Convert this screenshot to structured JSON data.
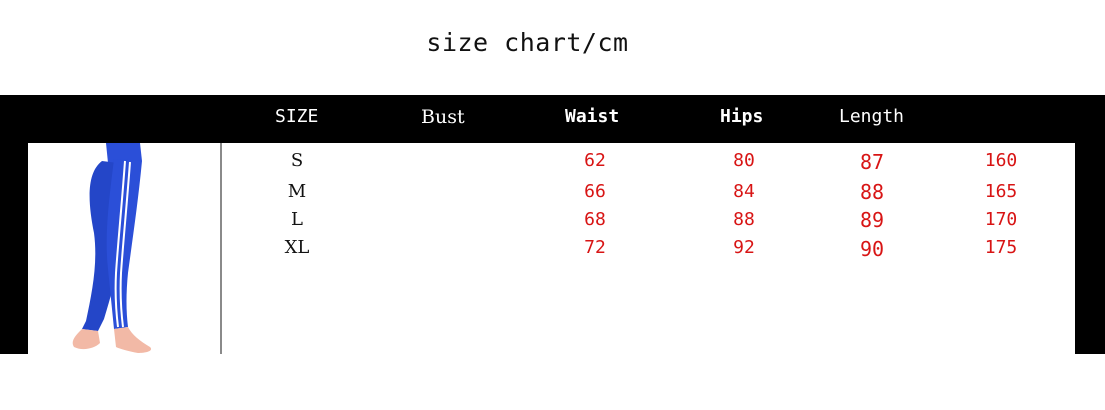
{
  "title": "size chart/cm",
  "headers": {
    "size": "SIZE",
    "bust": "Bust",
    "waist": "Waist",
    "hips": "Hips",
    "length": "Length"
  },
  "rows": [
    {
      "size": "S",
      "c1": "62",
      "c2": "80",
      "c3": "87",
      "c4": "160"
    },
    {
      "size": "M",
      "c1": "66",
      "c2": "84",
      "c3": "88",
      "c4": "165"
    },
    {
      "size": "L",
      "c1": "68",
      "c2": "88",
      "c3": "89",
      "c4": "170"
    },
    {
      "size": "XL",
      "c1": "72",
      "c2": "92",
      "c3": "90",
      "c4": "175"
    }
  ],
  "colors": {
    "frame": "#000000",
    "value_text": "#d81414",
    "leggings": "#2b4fd8",
    "stripe": "#ffffff",
    "skin": "#f2b9a6"
  },
  "product_image": "blue-leggings-with-white-side-stripes"
}
